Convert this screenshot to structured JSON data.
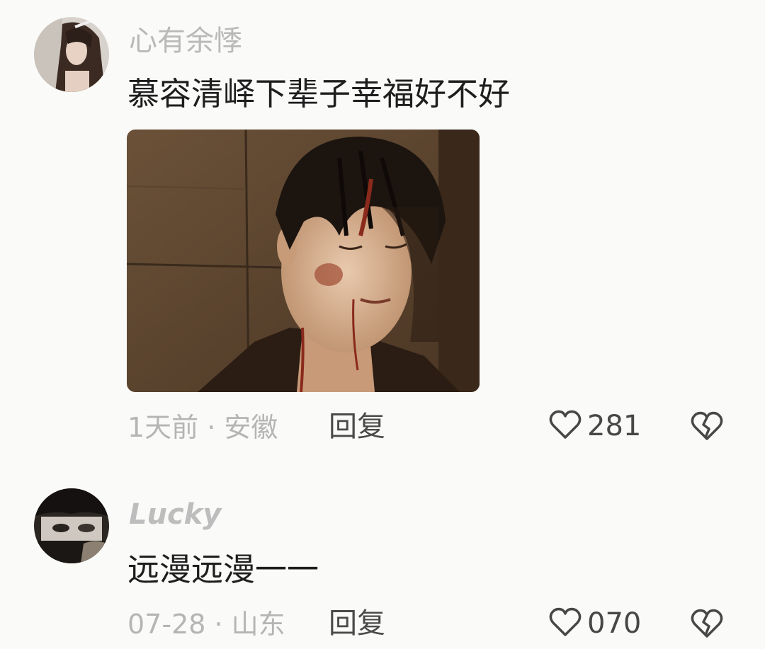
{
  "comments": [
    {
      "username": "心有余悸",
      "text": "慕容清峄下辈子幸福好不好",
      "meta": "1天前 · 安徽",
      "reply_label": "回复",
      "likes": "281",
      "has_image": true
    },
    {
      "username": "Lucky",
      "text": "远漫远漫一一",
      "meta": "07-28 · 山东",
      "reply_label": "回复",
      "likes": "070",
      "has_image": false
    }
  ],
  "icons": {
    "like": "heart-outline-icon",
    "dislike": "broken-heart-icon"
  },
  "colors": {
    "background": "#fafaf8",
    "username": "#b9b9b9",
    "text": "#1e1e1e",
    "meta": "#b5b5b5",
    "action": "#474747"
  }
}
